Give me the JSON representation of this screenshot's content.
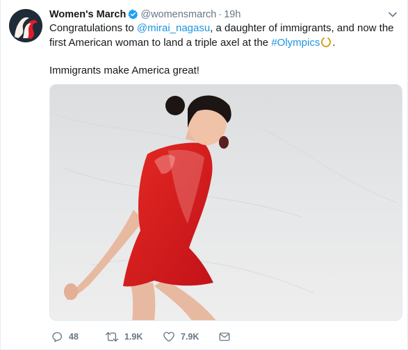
{
  "tweet": {
    "display_name": "Women's March",
    "handle": "@womensmarch",
    "separator": "·",
    "timestamp": "19h",
    "text_part1": "Congratulations to ",
    "mention": "@mirai_nagasu",
    "text_part2": ", a daughter of immigrants, and now the first American woman to land a triple axel at the ",
    "hashtag": "#Olympics",
    "text_part3": ".",
    "text_line2": "Immigrants make America great!"
  },
  "actions": {
    "reply_count": "48",
    "retweet_count": "1.9K",
    "like_count": "7.9K"
  },
  "icons": {
    "verified": "verified-badge-icon",
    "caret": "chevron-down-icon",
    "wreath": "olympic-wreath-emoji",
    "reply": "reply-icon",
    "retweet": "retweet-icon",
    "like": "heart-icon",
    "dm": "direct-message-icon"
  },
  "colors": {
    "link": "#1b95e0",
    "verified": "#1da1f2",
    "secondary_text": "#657786",
    "dress": "#d8161b"
  }
}
